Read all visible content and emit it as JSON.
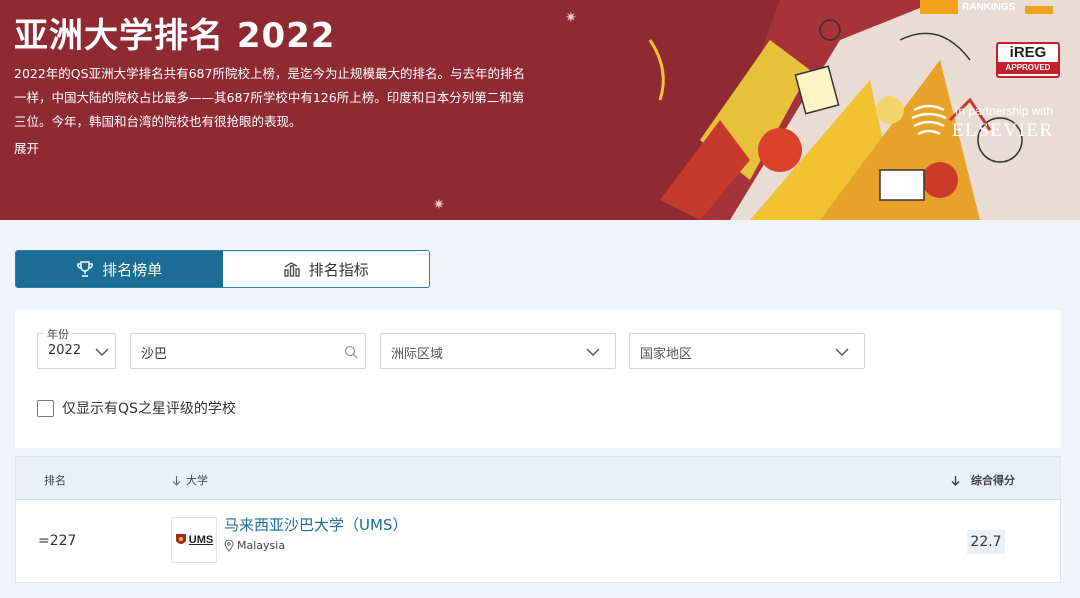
{
  "hero": {
    "title": "亚洲大学排名 2022",
    "description": "2022年的QS亚洲大学排名共有687所院校上榜，是迄今为止规模最大的排名。与去年的排名一样，中国大陆的院校占比最多——其687所学校中有126所上榜。印度和日本分列第二和第三位。今年，韩国和台湾的院校也有很抢眼的表现。",
    "expand_label": "展开",
    "rankings_badge": "RANKINGS",
    "ireg_title": "iREG",
    "ireg_sub": "APPROVED",
    "partner_text": "In partnership with",
    "partner_name": "ELSEVIER"
  },
  "tabs": [
    {
      "label": "排名榜单",
      "active": true,
      "icon": "trophy-icon"
    },
    {
      "label": "排名指标",
      "active": false,
      "icon": "bar-chart-icon"
    }
  ],
  "filters": {
    "year_legend": "年份",
    "year_value": "2022",
    "search_value": "沙巴",
    "region_placeholder": "洲际区域",
    "country_placeholder": "国家地区",
    "qs_stars_label": "仅显示有QS之星评级的学校"
  },
  "table": {
    "headers": {
      "rank": "排名",
      "university": "大学",
      "score": "综合得分"
    },
    "rows": [
      {
        "rank": "=227",
        "name": "马来西亚沙巴大学（UMS）",
        "logo_text": "UMS",
        "location": "Malaysia",
        "score": "22.7"
      }
    ]
  },
  "colors": {
    "hero_bg": "#8f2a33",
    "accent": "#1b6d95",
    "header_bg": "#e9f1f7"
  }
}
